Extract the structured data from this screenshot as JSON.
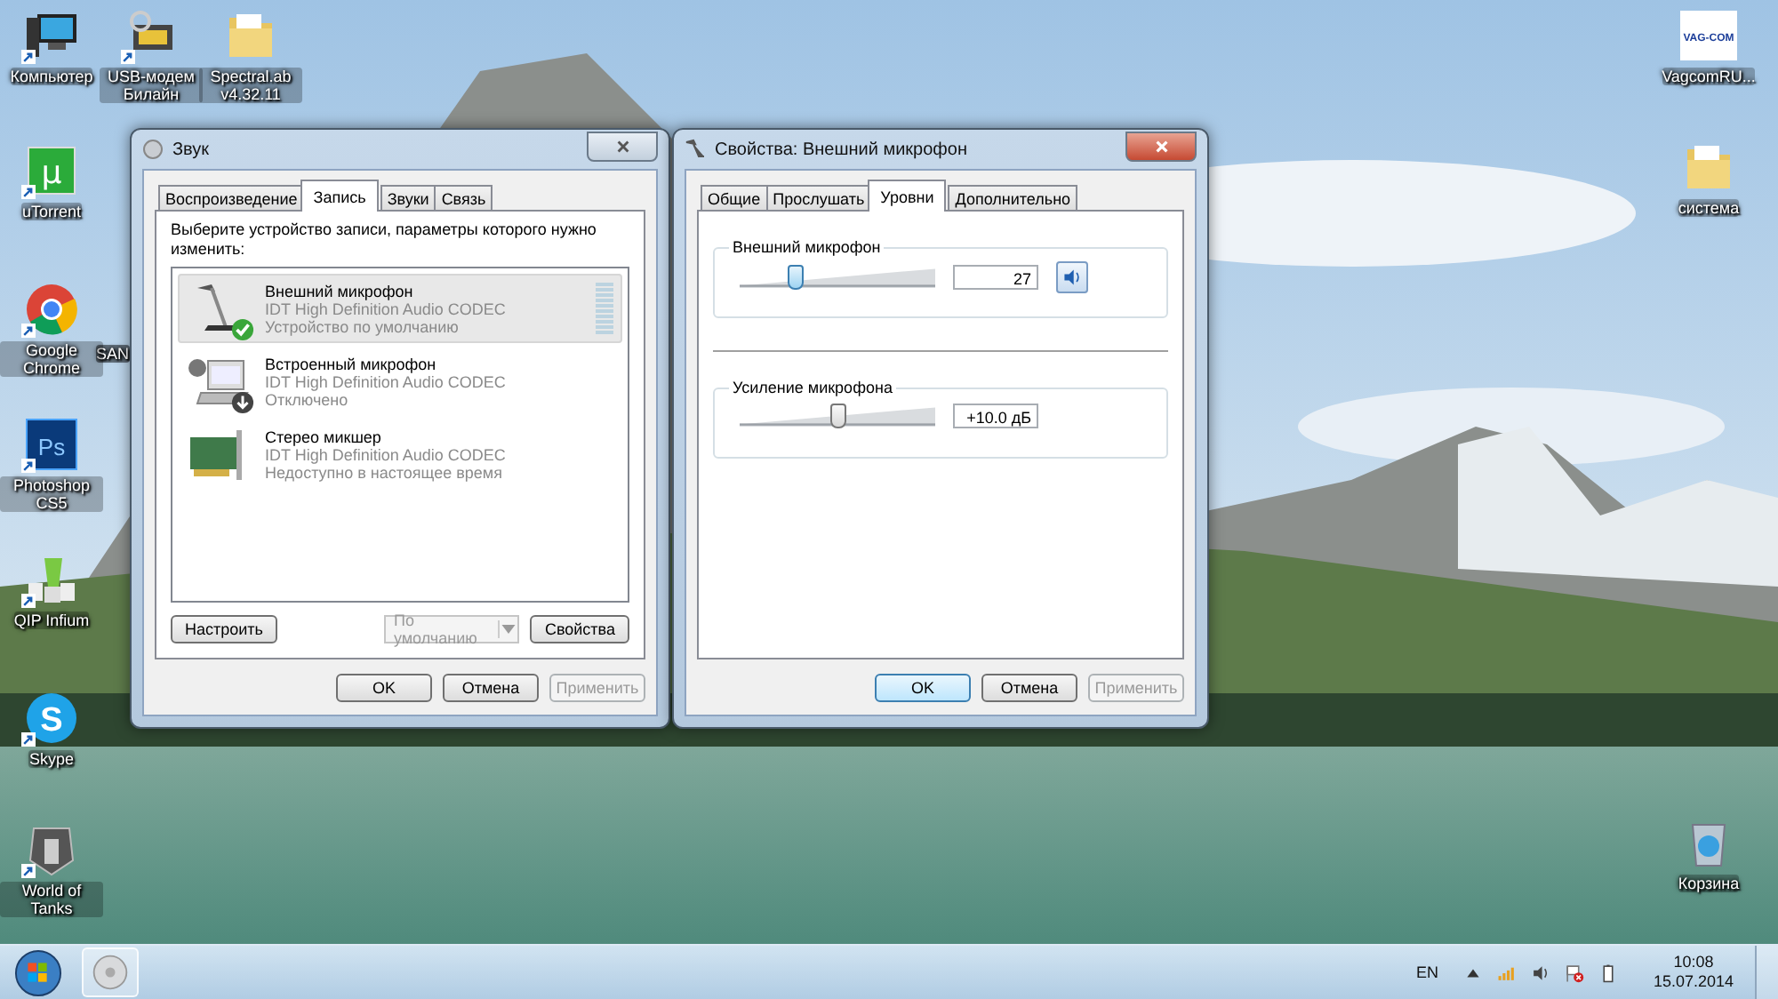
{
  "desktop_icons": [
    {
      "label": "Компьютер",
      "kind": "computer",
      "shortcut": true
    },
    {
      "label": "USB-модем Билайн",
      "kind": "modem",
      "shortcut": true
    },
    {
      "label": "Spectral.ab v4.32.11",
      "kind": "folder",
      "shortcut": false
    },
    {
      "label": "uTorrent",
      "kind": "utorrent",
      "glyph": "µ",
      "shortcut": true
    },
    {
      "label": "Google Chrome",
      "kind": "chrome",
      "shortcut": true
    },
    {
      "label": "Photoshop CS5",
      "kind": "photoshop",
      "glyph": "Ps",
      "shortcut": true
    },
    {
      "label": "QIP Infium",
      "kind": "qip",
      "shortcut": true
    },
    {
      "label": "Skype",
      "kind": "skype",
      "glyph": "S",
      "shortcut": true
    },
    {
      "label": "World of Tanks",
      "kind": "wot",
      "shortcut": true
    },
    {
      "label": "VagcomRU...",
      "kind": "vagcom",
      "glyph": "VAG-COM",
      "shortcut": false
    },
    {
      "label": "система",
      "kind": "folder",
      "shortcut": false
    },
    {
      "label": "Корзина",
      "kind": "bin",
      "shortcut": false
    }
  ],
  "partial_icon_label": "SAN",
  "sound_dialog": {
    "title": "Звук",
    "tabs": [
      {
        "label": "Воспроизведение",
        "selected": false
      },
      {
        "label": "Запись",
        "selected": true
      },
      {
        "label": "Звуки",
        "selected": false
      },
      {
        "label": "Связь",
        "selected": false
      }
    ],
    "instruction": "Выберите устройство записи, параметры которого нужно изменить:",
    "devices": [
      {
        "name": "Внешний микрофон",
        "driver": "IDT High Definition Audio CODEC",
        "status": "Устройство по умолчанию",
        "kind": "microphone",
        "is_default": true,
        "disabled": false,
        "selected": true
      },
      {
        "name": "Встроенный микрофон",
        "driver": "IDT High Definition Audio CODEC",
        "status": "Отключено",
        "kind": "laptop",
        "is_default": false,
        "disabled": true,
        "selected": false
      },
      {
        "name": "Стерео микшер",
        "driver": "IDT High Definition Audio CODEC",
        "status": "Недоступно в настоящее время",
        "kind": "card",
        "is_default": false,
        "disabled": false,
        "selected": false
      }
    ],
    "configure_button": "Настроить",
    "default_dropdown": {
      "value": "По умолчанию",
      "disabled": true
    },
    "properties_button": "Свойства",
    "buttons": [
      {
        "label": "OK",
        "disabled": false,
        "default": false
      },
      {
        "label": "Отмена",
        "disabled": false,
        "default": false
      },
      {
        "label": "Применить",
        "disabled": true,
        "default": false
      }
    ]
  },
  "properties_dialog": {
    "title": "Свойства: Внешний микрофон",
    "tabs": [
      {
        "label": "Общие",
        "selected": false
      },
      {
        "label": "Прослушать",
        "selected": false
      },
      {
        "label": "Уровни",
        "selected": true
      },
      {
        "label": "Дополнительно",
        "selected": false
      }
    ],
    "levels": [
      {
        "label": "Внешний микрофон",
        "level": 0.27,
        "value": "27",
        "focused": true,
        "muted": false
      },
      {
        "label": "Усиление микрофона",
        "level": 0.5,
        "value": "+10.0 дБ",
        "focused": false
      }
    ],
    "buttons": [
      {
        "label": "OK",
        "disabled": false,
        "default": true
      },
      {
        "label": "Отмена",
        "disabled": false,
        "default": false
      },
      {
        "label": "Применить",
        "disabled": true,
        "default": false
      }
    ]
  },
  "taskbar": {
    "language": "EN",
    "time": "10:08",
    "date": "15.07.2014"
  }
}
